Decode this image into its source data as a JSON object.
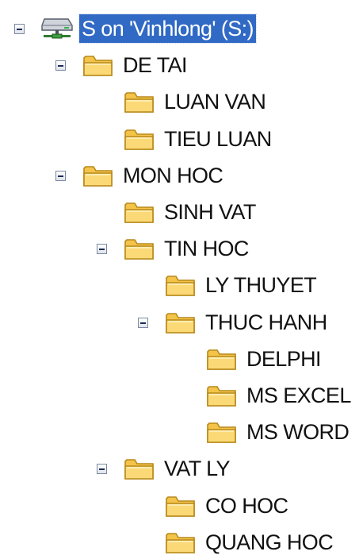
{
  "colors": {
    "selection_background": "#316ac5",
    "selection_text": "#ffffff",
    "folder_yellow": "#f4c44a",
    "expander_border": "#7b8aa0"
  },
  "tree": {
    "nodes": [
      {
        "id": "drive-s",
        "label": "S on 'Vinhlong' (S:)",
        "depth": 0,
        "icon": "network-drive-icon",
        "expanded": true,
        "selected": true
      },
      {
        "id": "de-tai",
        "label": "DE TAI",
        "depth": 1,
        "icon": "folder-icon",
        "expanded": true,
        "selected": false
      },
      {
        "id": "luan-van",
        "label": "LUAN VAN",
        "depth": 2,
        "icon": "folder-icon",
        "expanded": null,
        "selected": false
      },
      {
        "id": "tieu-luan",
        "label": "TIEU LUAN",
        "depth": 2,
        "icon": "folder-icon",
        "expanded": null,
        "selected": false
      },
      {
        "id": "mon-hoc",
        "label": "MON HOC",
        "depth": 1,
        "icon": "folder-icon",
        "expanded": true,
        "selected": false
      },
      {
        "id": "sinh-vat",
        "label": "SINH VAT",
        "depth": 2,
        "icon": "folder-icon",
        "expanded": null,
        "selected": false
      },
      {
        "id": "tin-hoc",
        "label": "TIN HOC",
        "depth": 2,
        "icon": "folder-icon",
        "expanded": true,
        "selected": false
      },
      {
        "id": "ly-thuyet",
        "label": "LY THUYET",
        "depth": 3,
        "icon": "folder-icon",
        "expanded": null,
        "selected": false
      },
      {
        "id": "thuc-hanh",
        "label": "THUC HANH",
        "depth": 3,
        "icon": "folder-icon",
        "expanded": true,
        "selected": false
      },
      {
        "id": "delphi",
        "label": "DELPHI",
        "depth": 4,
        "icon": "folder-icon",
        "expanded": null,
        "selected": false
      },
      {
        "id": "ms-excel",
        "label": "MS EXCEL",
        "depth": 4,
        "icon": "folder-icon",
        "expanded": null,
        "selected": false
      },
      {
        "id": "ms-word",
        "label": "MS WORD",
        "depth": 4,
        "icon": "folder-icon",
        "expanded": null,
        "selected": false
      },
      {
        "id": "vat-ly",
        "label": "VAT LY",
        "depth": 2,
        "icon": "folder-icon",
        "expanded": true,
        "selected": false
      },
      {
        "id": "co-hoc",
        "label": "CO HOC",
        "depth": 3,
        "icon": "folder-icon",
        "expanded": null,
        "selected": false
      },
      {
        "id": "quang-hoc",
        "label": "QUANG HOC",
        "depth": 3,
        "icon": "folder-icon",
        "expanded": null,
        "selected": false
      }
    ]
  }
}
